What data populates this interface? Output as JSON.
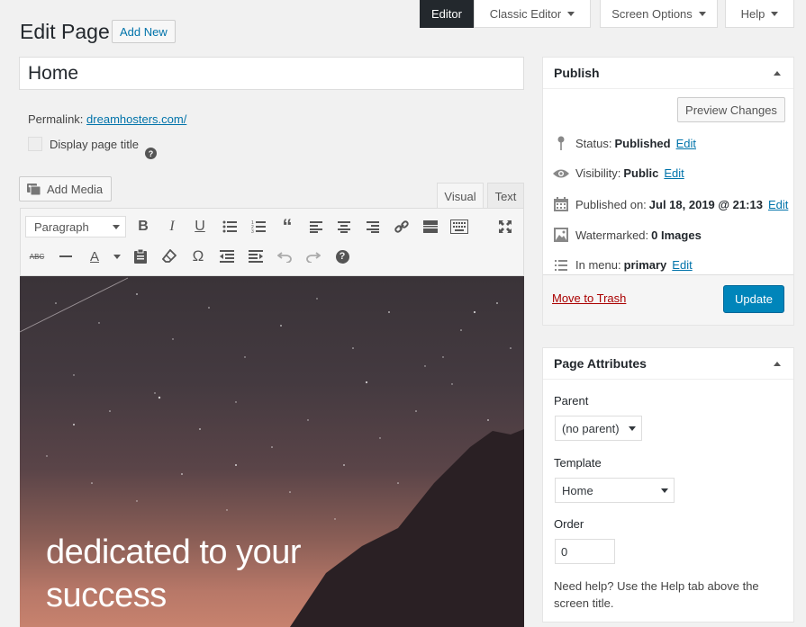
{
  "top_tabs": {
    "editor": "Editor",
    "classic": "Classic Editor",
    "screen_options": "Screen Options",
    "help": "Help"
  },
  "header": {
    "title": "Edit Page",
    "add_new": "Add New"
  },
  "post_title": "Home",
  "permalink": {
    "label": "Permalink:",
    "url": "dreamhosters.com/"
  },
  "display_page_title": "Display page title",
  "add_media": "Add Media",
  "editor_tabs": {
    "visual": "Visual",
    "text": "Text"
  },
  "toolbar": {
    "format": "Paragraph",
    "help_glyph": "?"
  },
  "hero": {
    "line1": "dedicated to your",
    "line2": "success"
  },
  "publish": {
    "title": "Publish",
    "preview": "Preview Changes",
    "status_label": "Status:",
    "status_value": "Published",
    "visibility_label": "Visibility:",
    "visibility_value": "Public",
    "published_label": "Published on:",
    "published_value": "Jul 18, 2019 @ 21:13",
    "watermarked_label": "Watermarked:",
    "watermarked_value": "0 Images",
    "menu_label": "In menu:",
    "menu_value": "primary",
    "edit": "Edit",
    "trash": "Move to Trash",
    "update": "Update"
  },
  "attributes": {
    "title": "Page Attributes",
    "parent_label": "Parent",
    "parent_value": "(no parent)",
    "template_label": "Template",
    "template_value": "Home",
    "order_label": "Order",
    "order_value": "0",
    "help": "Need help? Use the Help tab above the screen title."
  },
  "colors": {
    "link": "#0073aa",
    "primary": "#0085ba",
    "trash": "#a00",
    "dark": "#23282d"
  }
}
